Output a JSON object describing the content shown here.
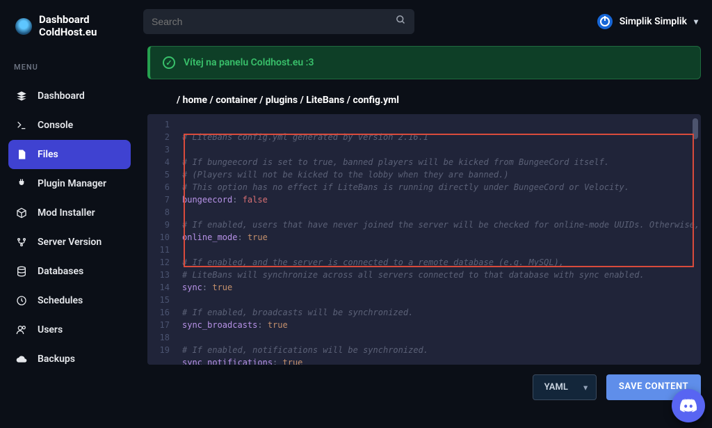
{
  "brand": {
    "line1": "Dashboard",
    "line2": "ColdHost.eu"
  },
  "search": {
    "placeholder": "Search"
  },
  "user": {
    "name": "Simplik Simplik"
  },
  "menu_label": "MENU",
  "nav": {
    "dashboard": "Dashboard",
    "console": "Console",
    "files": "Files",
    "plugin_manager": "Plugin Manager",
    "mod_installer": "Mod Installer",
    "server_version": "Server Version",
    "databases": "Databases",
    "schedules": "Schedules",
    "users": "Users",
    "backups": "Backups"
  },
  "banner": {
    "text": "Vítej na panelu Coldhost.eu :3"
  },
  "breadcrumb": "/ home / container / plugins / LiteBans / config.yml",
  "lang_select": "YAML",
  "save_button": "SAVE CONTENT",
  "code": {
    "l1": "# LiteBans config.yml generated by version 2.16.1",
    "l2": "",
    "l3": "# If bungeecord is set to true, banned players will be kicked from BungeeCord itself.",
    "l4": "# (Players will not be kicked to the lobby when they are banned.)",
    "l5": "# This option has no effect if LiteBans is running directly under BungeeCord or Velocity.",
    "l6k": "bungeecord",
    "l6v": "false",
    "l7": "",
    "l8": "# If enabled, users that have never joined the server will be checked for online-mode UUIDs. Otherwise, offline-mode UUIDs will be used.",
    "l9k": "online_mode",
    "l9v": "true",
    "l10": "",
    "l11": "# If enabled, and the server is connected to a remote database (e.g. MySQL),",
    "l12": "# LiteBans will synchronize across all servers connected to that database with sync enabled.",
    "l13k": "sync",
    "l13v": "true",
    "l14": "",
    "l15": "# If enabled, broadcasts will be synchronized.",
    "l16k": "sync_broadcasts",
    "l16v": "true",
    "l17": "",
    "l18": "# If enabled, notifications will be synchronized.",
    "l19k": "sync_notifications",
    "l19v": "true"
  }
}
